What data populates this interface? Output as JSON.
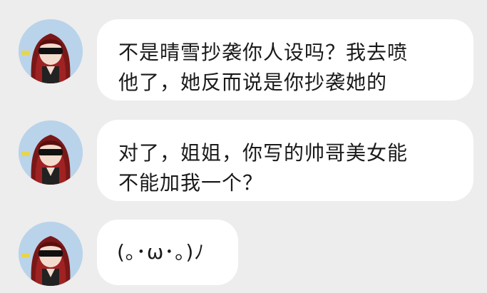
{
  "chat": {
    "messages": [
      {
        "lines": [
          "不是晴雪抄袭你人设吗？我去喷",
          "他了，她反而说是你抄袭她的"
        ]
      },
      {
        "lines": [
          "对了，姐姐，你写的帅哥美女能",
          "不能加我一个？"
        ]
      },
      {
        "lines": [
          "(｡･ω･｡)ﾉ"
        ]
      }
    ]
  }
}
